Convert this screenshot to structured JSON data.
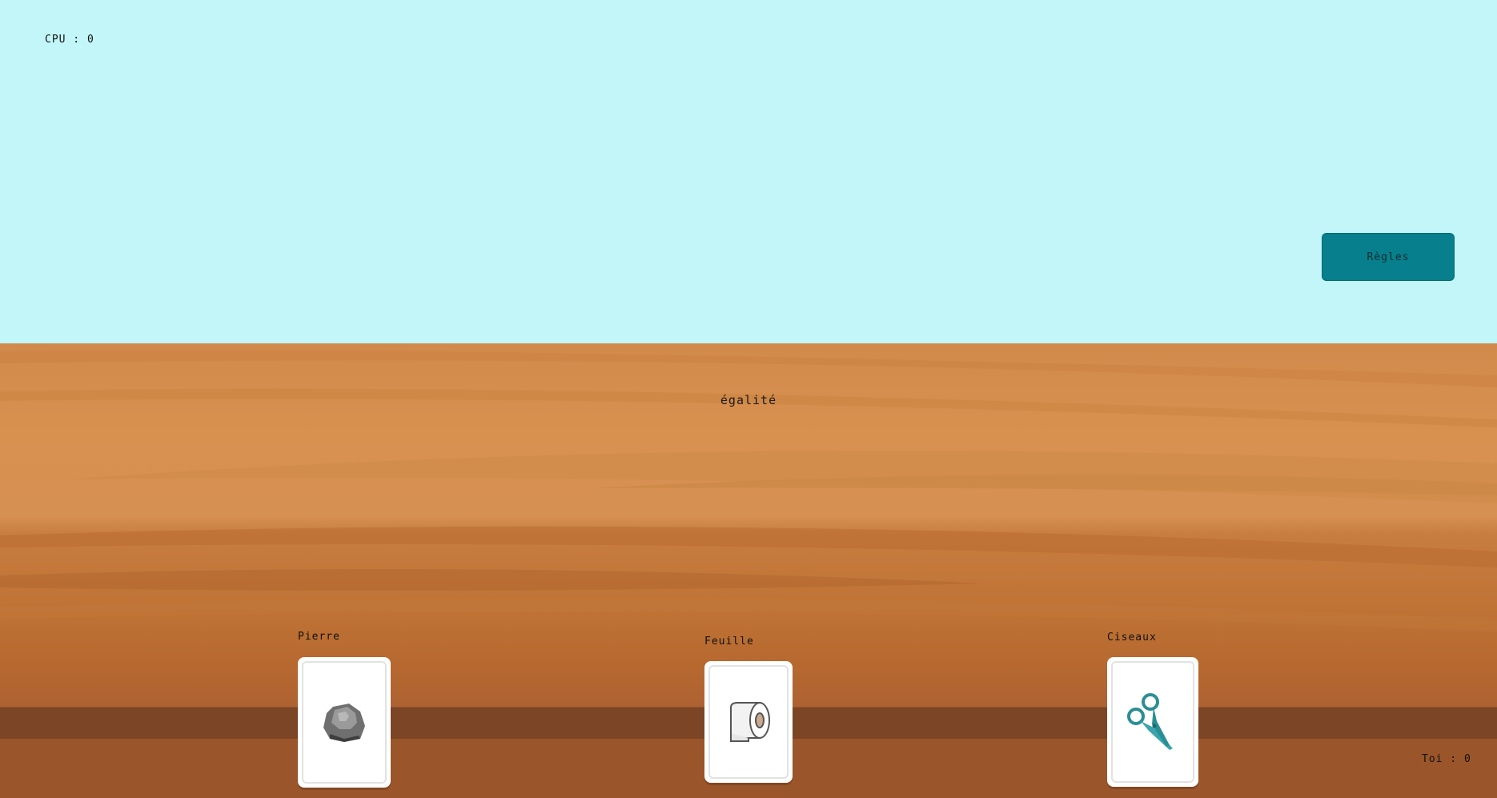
{
  "hud": {
    "cpu_score": "CPU : 0",
    "player_score": "Toi : 0"
  },
  "rules_button": {
    "label": "Règles"
  },
  "result": {
    "text": "égalité"
  },
  "cards": [
    {
      "label": "Pierre",
      "icon": "rock-icon"
    },
    {
      "label": "Feuille",
      "icon": "toilet-paper-icon"
    },
    {
      "label": "Ciseaux",
      "icon": "scissors-icon"
    }
  ],
  "colors": {
    "sky": "#c2f6f8",
    "table": "#d28a4c",
    "button": "#077f8c",
    "card": "#ffffff"
  }
}
